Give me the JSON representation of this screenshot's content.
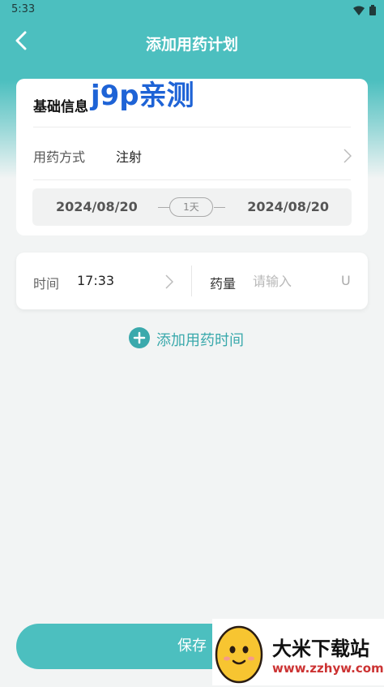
{
  "status": {
    "time": "5:33"
  },
  "nav": {
    "title": "添加用药计划"
  },
  "basic": {
    "section_title": "基础信息",
    "method_label": "用药方式",
    "method_value": "注射",
    "start_date": "2024/08/20",
    "days": "1天",
    "end_date": "2024/08/20"
  },
  "watermark": "j9p亲测",
  "time_row": {
    "time_label": "时间",
    "time_value": "17:33",
    "dose_label": "药量",
    "dose_placeholder": "请输入",
    "unit": "U"
  },
  "add_time_label": "添加用药时间",
  "save_label": "保存",
  "ad": {
    "name": "大米下载站",
    "url": "www.zzhyw.com"
  },
  "colors": {
    "accent": "#4cbfbf",
    "accent_text": "#3aa9ac",
    "watermark": "#1e63d6"
  },
  "icons": [
    "wifi-icon",
    "battery-icon",
    "back-arrow-icon",
    "chevron-right-icon",
    "plus-circle-icon",
    "egg-mascot-icon"
  ]
}
